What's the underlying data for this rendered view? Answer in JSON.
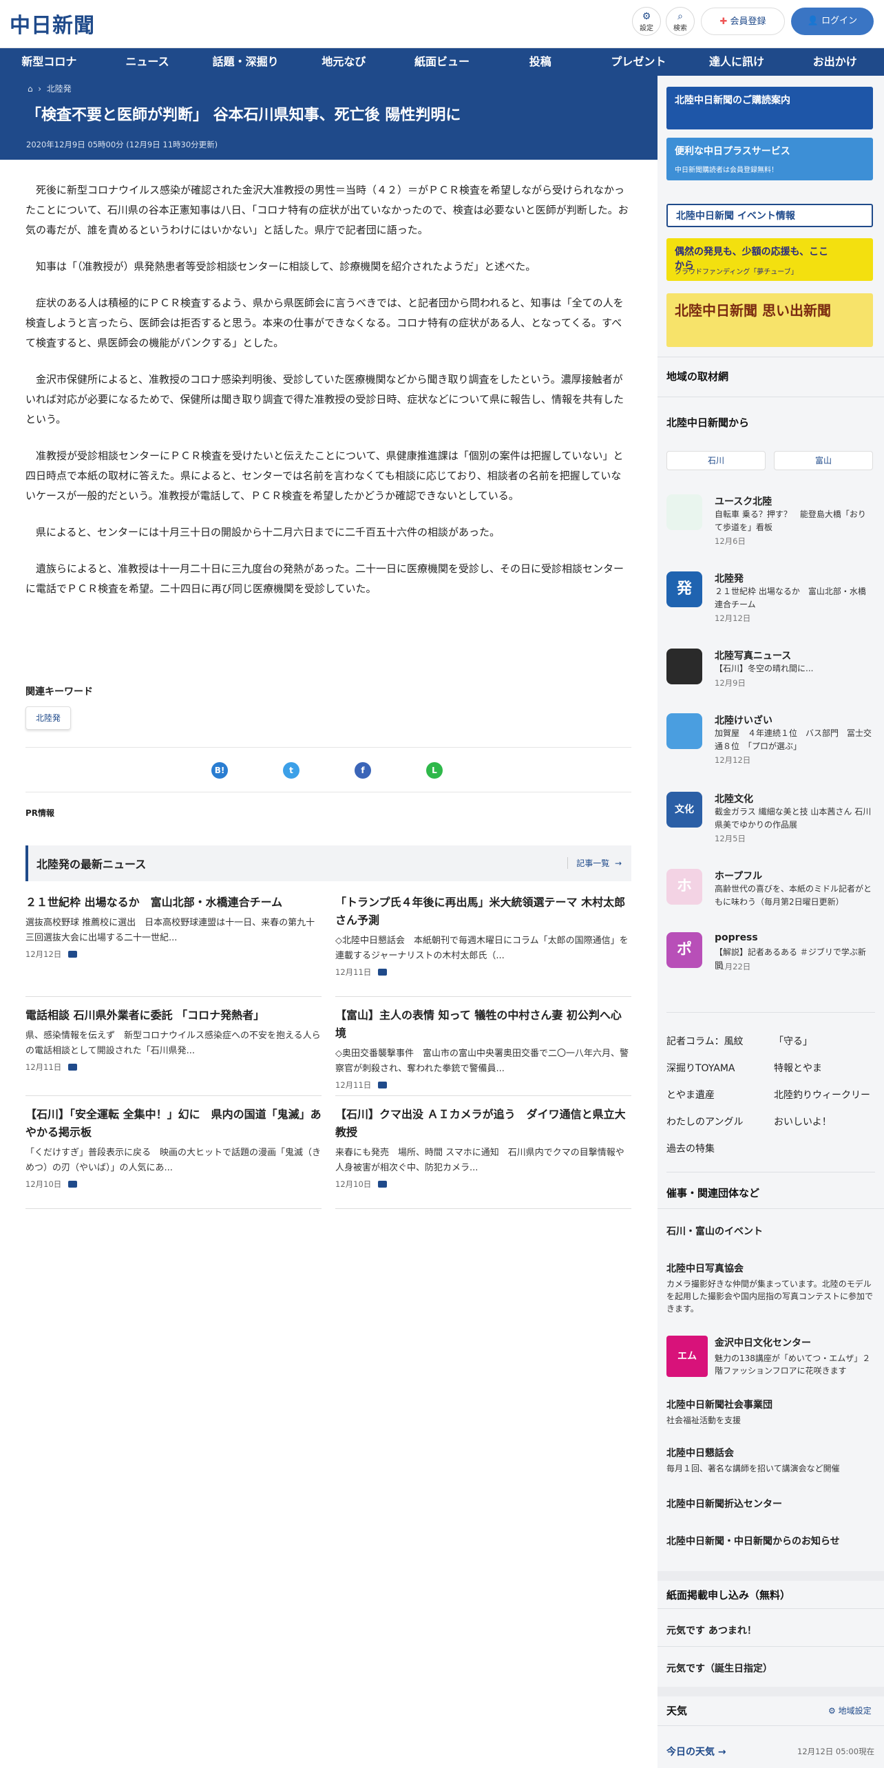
{
  "header": {
    "logo": "中日新聞",
    "settings_label": "設定",
    "search_label": "検索",
    "register_label": "会員登録",
    "login_label": "ログイン"
  },
  "nav": [
    "新型コロナ",
    "ニュース",
    "話題・深掘り",
    "地元なび",
    "紙面ビュー",
    "投稿",
    "プレゼント",
    "達人に訊け",
    "お出かけ"
  ],
  "breadcrumb": {
    "current": "北陸発"
  },
  "article": {
    "title": "「検査不要と医師が判断」 谷本石川県知事、死亡後 陽性判明に",
    "date": "2020年12月9日 05時00分 (12月9日 11時30分更新)",
    "paragraphs": [
      "死後に新型コロナウイルス感染が確認された金沢大准教授の男性＝当時（４２）＝がＰＣＲ検査を希望しながら受けられなかったことについて、石川県の谷本正憲知事は八日、「コロナ特有の症状が出ていなかったので、検査は必要ないと医師が判断した。お気の毒だが、誰を責めるというわけにはいかない」と話した。県庁で記者団に語った。",
      "知事は「（准教授が）県発熱患者等受診相談センターに相談して、診療機関を紹介されたようだ」と述べた。",
      "症状のある人は積極的にＰＣＲ検査するよう、県から県医師会に言うべきでは、と記者団から問われると、知事は「全ての人を検査しようと言ったら、医師会は拒否すると思う。本来の仕事ができなくなる。コロナ特有の症状がある人、となってくる。すべて検査すると、県医師会の機能がパンクする」とした。",
      "金沢市保健所によると、准教授のコロナ感染判明後、受診していた医療機関などから聞き取り調査をしたという。濃厚接触者がいれば対応が必要になるためで、保健所は聞き取り調査で得た准教授の受診日時、症状などについて県に報告し、情報を共有したという。",
      "准教授が受診相談センターにＰＣＲ検査を受けたいと伝えたことについて、県健康推進課は「個別の案件は把握していない」と四日時点で本紙の取材に答えた。県によると、センターでは名前を言わなくても相談に応じており、相談者の名前を把握していないケースが一般的だという。准教授が電話して、ＰＣＲ検査を希望したかどうか確認できないとしている。",
      "県によると、センターには十月三十日の開設から十二月六日までに二千百五十六件の相談があった。",
      "遺族らによると、准教授は十一月二十日に三九度台の発熱があった。二十一日に医療機関を受診し、その日に受診相談センターに電話でＰＣＲ検査を希望。二十四日に再び同じ医療機関を受診していた。"
    ]
  },
  "keywords": {
    "label": "関連キーワード",
    "items": [
      "北陸発"
    ]
  },
  "share": [
    "B!",
    "t",
    "f",
    "L"
  ],
  "pr_label": "PR情報",
  "latest": {
    "title": "北陸発の最新ニュース",
    "more": "記事一覧",
    "items": [
      {
        "title": "２１世紀枠 出場なるか　富山北部・水橋連合チーム",
        "desc": "選抜高校野球 推薦校に選出　日本高校野球連盟は十一日、来春の第九十三回選抜大会に出場する二十一世紀...",
        "date": "12月12日"
      },
      {
        "title": "「トランプ氏４年後に再出馬」米大統領選テーマ 木村太郎さん予測",
        "desc": "◇北陸中日懇話会　本紙朝刊で毎週木曜日にコラム「太郎の国際通信」を連載するジャーナリストの木村太郎氏（...",
        "date": "12月11日"
      },
      {
        "title": "電話相談 石川県外業者に委託 「コロナ発熱者」",
        "desc": "県、感染情報を伝えず　新型コロナウイルス感染症への不安を抱える人らの電話相談として開設された「石川県発...",
        "date": "12月11日"
      },
      {
        "title": "【富山】主人の表情 知って 犠牲の中村さん妻 初公判へ心境",
        "desc": "◇奥田交番襲撃事件　富山市の富山中央署奥田交番で二〇一八年六月、警察官が刺殺され、奪われた拳銃で警備員...",
        "date": "12月11日"
      },
      {
        "title": "【石川】「安全運転 全集中！」幻に　県内の国道「鬼滅」あやかる掲示板",
        "desc": "「くだけすぎ」普段表示に戻る　映画の大ヒットで話題の漫画「鬼滅（きめつ）の刃（やいば）」の人気にあ...",
        "date": "12月10日"
      },
      {
        "title": "【石川】クマ出没 ＡＩカメラが追う　ダイワ通信と県立大教授",
        "desc": "来春にも発売　場所、時間 スマホに通知　石川県内でクマの目撃情報や人身被害が相次ぐ中、防犯カメラ...",
        "date": "12月10日"
      }
    ]
  },
  "sidebar": {
    "banners": [
      {
        "text": "北陸中日新聞のご購読案内",
        "sub": ""
      },
      {
        "text": "便利な中日プラスサービス",
        "sub": "中日新聞購読者は会員登録無料！"
      },
      {
        "text": "北陸中日新聞 イベント情報",
        "sub": ""
      },
      {
        "text": "偶然の発見も、少額の応援も、ここから",
        "sub": "クラウドファンディング「夢チューブ」"
      },
      {
        "text": "北陸中日新聞 思い出新聞",
        "sub": ""
      }
    ],
    "region_title": "地域の取材網",
    "from_title": "北陸中日新聞から",
    "region_buttons": [
      "石川",
      "富山"
    ],
    "columns": [
      {
        "name": "ユースク北陸",
        "desc": "自転車 乗る？押す？　能登島大橋「おりて歩道を」看板",
        "date": "12月6日",
        "icon": "yousuku-logo-icon",
        "color": "#e9f5ee"
      },
      {
        "name": "北陸発",
        "desc": "２１世紀枠 出場なるか　富山北部・水橋連合チーム",
        "date": "12月12日",
        "icon": "hatsu-icon",
        "color": "#1f63b0",
        "glyph": "発"
      },
      {
        "name": "北陸写真ニュース",
        "desc": "【石川】冬空の晴れ間に...",
        "date": "12月9日",
        "icon": "camera-icon",
        "color": "#2a2a2a"
      },
      {
        "name": "北陸けいざい",
        "desc": "加賀屋　４年連続１位　バス部門　冨士交通８位　「プロが選ぶ」",
        "date": "12月12日",
        "icon": "chart-up-icon",
        "color": "#4a9ee0"
      },
      {
        "name": "北陸文化",
        "desc": "截金ガラス 繊細な美と技 山本茜さん 石川県美でゆかりの作品展",
        "date": "12月5日",
        "icon": "bunka-icon",
        "color": "#2b5fa6",
        "glyph": "文化"
      },
      {
        "name": "ホープフル",
        "desc": "高齢世代の喜びを、本紙のミドル記者がともに味わう（毎月第2日曜日更新）",
        "date": "",
        "icon": "hopeful-icon",
        "color": "#f3d3e4",
        "glyph": "ホ"
      },
      {
        "name": "popress",
        "desc": "【解説】記者あるある ＃ジブリで学ぶ新聞",
        "date": "11月22日",
        "icon": "popress-icon",
        "color": "#b84fb8",
        "glyph": "ポ"
      }
    ],
    "links": [
      "記者コラム：風紋",
      "「守る」",
      "深掘りTOYAMA",
      "特報とやま",
      "とやま遺産",
      "北陸釣りウィークリー",
      "わたしのアングル",
      "おいしいよ！",
      "過去の特集"
    ],
    "events_title": "催事・関連団体など",
    "events_sub": "石川・富山のイベント",
    "events": [
      {
        "name": "北陸中日写真協会",
        "desc": "カメラ撮影好きな仲間が集まっています。北陸のモデルを起用した撮影会や国内屈指の写真コンテストに参加できます。"
      },
      {
        "name": "金沢中日文化センター",
        "desc": "魅力の138講座が「めいてつ・エムザ」２階ファッションフロアに花咲きます"
      },
      {
        "name": "北陸中日新聞社会事業団",
        "desc": "社会福祉活動を支援"
      },
      {
        "name": "北陸中日懇話会",
        "desc": "毎月１回、著名な講師を招いて講演会など開催"
      },
      {
        "name": "北陸中日新聞折込センター",
        "desc": ""
      },
      {
        "name": "北陸中日新聞・中日新聞からのお知らせ",
        "desc": ""
      }
    ],
    "apply_title": "紙面掲載申し込み（無料）",
    "apply_items": [
      "元気です あつまれ！",
      "元気です（誕生日指定）"
    ],
    "weather_title": "天気",
    "weather_setting": "地域設定",
    "weather_today": "今日の天気",
    "weather_date": "12月12日 05:00現在"
  }
}
